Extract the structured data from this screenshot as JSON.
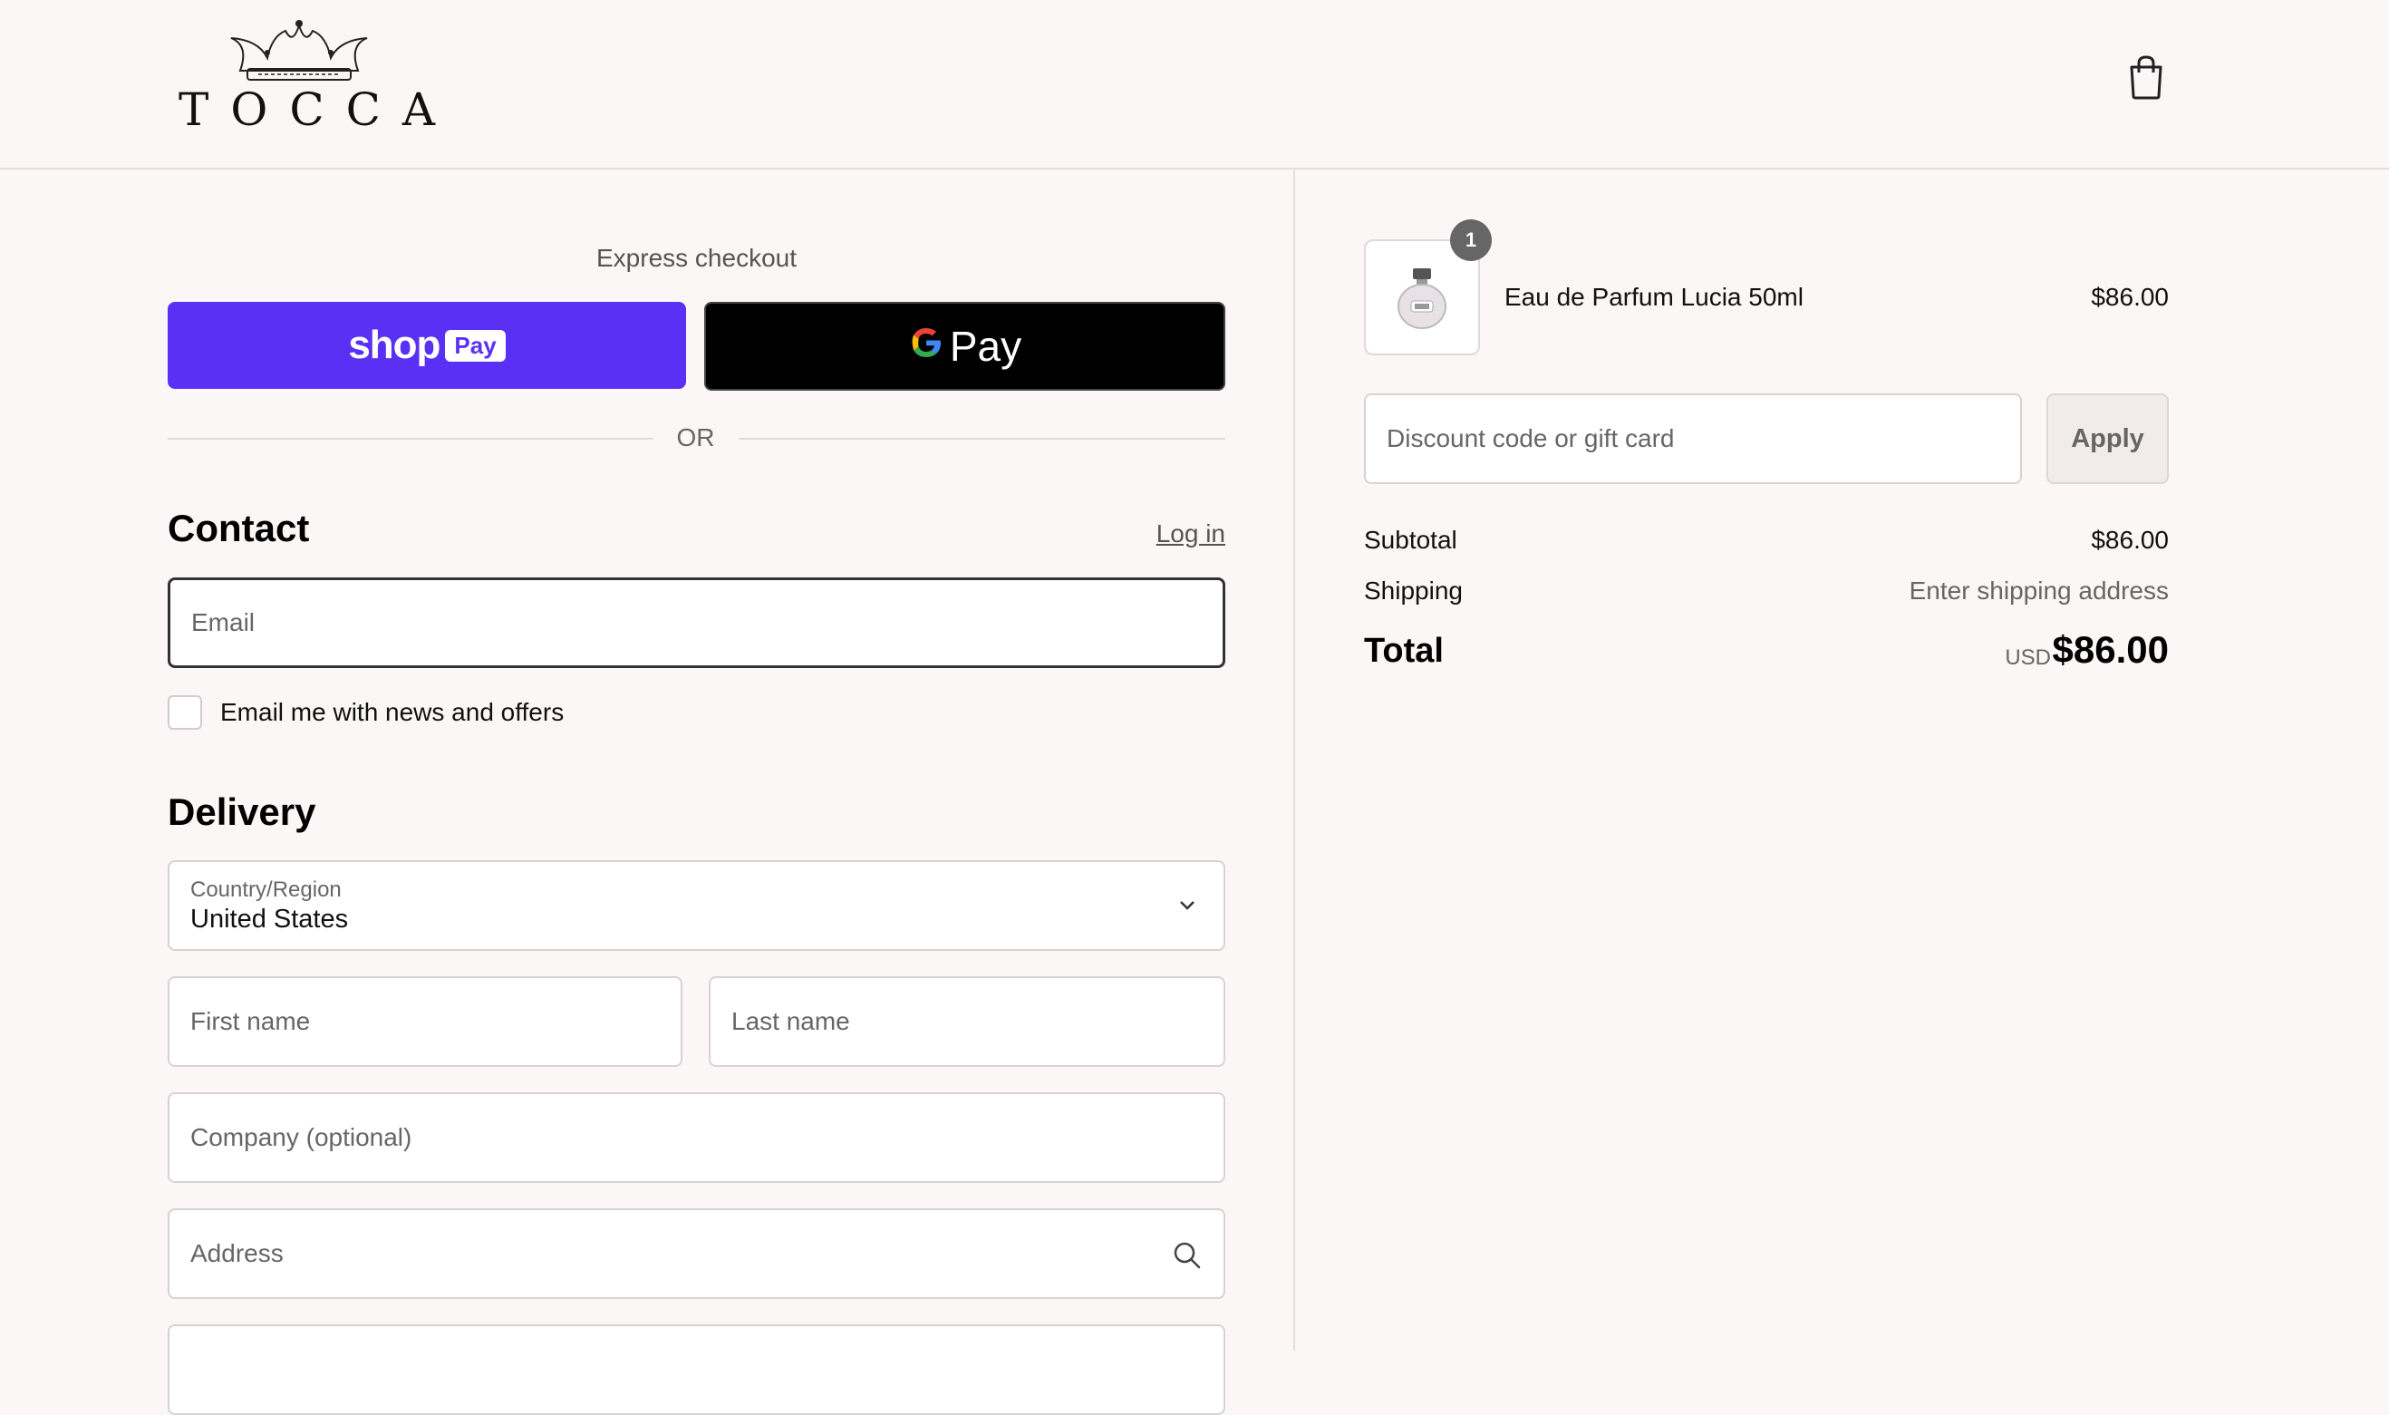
{
  "header": {
    "brand": "TOCCA",
    "icons": {
      "crown": "crown-logo",
      "cart": "shopping-bag-icon"
    }
  },
  "express": {
    "title": "Express checkout",
    "shoppay_text": "shop",
    "shoppay_badge": "Pay",
    "gpay_g": "G",
    "gpay_text": "Pay",
    "or": "OR"
  },
  "contact": {
    "heading": "Contact",
    "login": "Log in",
    "email_placeholder": "Email",
    "newsletter_label": "Email me with news and offers"
  },
  "delivery": {
    "heading": "Delivery",
    "country_label": "Country/Region",
    "country_value": "United States",
    "first_name": "First name",
    "last_name": "Last name",
    "company": "Company (optional)",
    "address": "Address"
  },
  "summary": {
    "quantity": "1",
    "product_name": "Eau de Parfum Lucia 50ml",
    "product_price": "$86.00",
    "discount_placeholder": "Discount code or gift card",
    "apply": "Apply",
    "subtotal_label": "Subtotal",
    "subtotal_value": "$86.00",
    "shipping_label": "Shipping",
    "shipping_value": "Enter shipping address",
    "total_label": "Total",
    "total_currency": "USD",
    "total_value": "$86.00"
  },
  "colors": {
    "background": "#faf7f6",
    "shoppay": "#5a31f4",
    "gpay": "#000000",
    "border": "#d9d2d2"
  }
}
